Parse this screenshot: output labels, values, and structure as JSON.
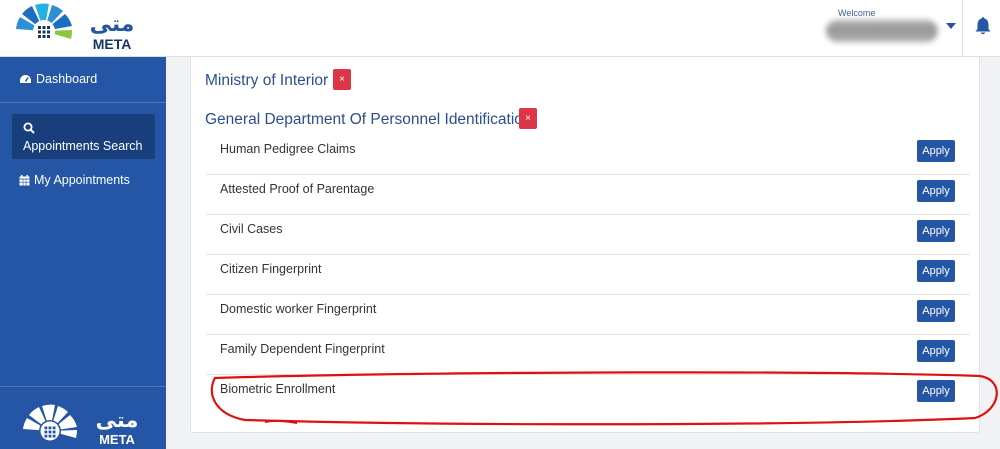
{
  "header": {
    "logo_arabic": "متى",
    "logo_latin": "META",
    "welcome_label": "Welcome",
    "user_name": "XXXXXXXXXXXXXXX..."
  },
  "sidebar": {
    "items": [
      {
        "label": "Dashboard",
        "icon": "gauge-icon"
      },
      {
        "label": "Appointments Search",
        "icon": "search-icon",
        "active": true
      },
      {
        "label": "My Appointments",
        "icon": "calendar-icon"
      }
    ],
    "footer_logo_arabic": "متى",
    "footer_logo_latin": "META"
  },
  "main": {
    "ministry": "Ministry of Interior",
    "department": "General Department Of Personnel Identification",
    "remove_symbol": "×",
    "apply_label": "Apply",
    "services": [
      "Human Pedigree Claims",
      "Attested Proof of Parentage",
      "Civil Cases",
      "Citizen Fingerprint",
      "Domestic worker Fingerprint",
      "Family Dependent Fingerprint",
      "Biometric Enrollment"
    ]
  },
  "colors": {
    "brand_blue": "#2456a5",
    "active_nav": "#183f7c",
    "title_blue": "#2a4f8f",
    "remove_red": "#dc3545",
    "annotation_red": "#e01010"
  }
}
